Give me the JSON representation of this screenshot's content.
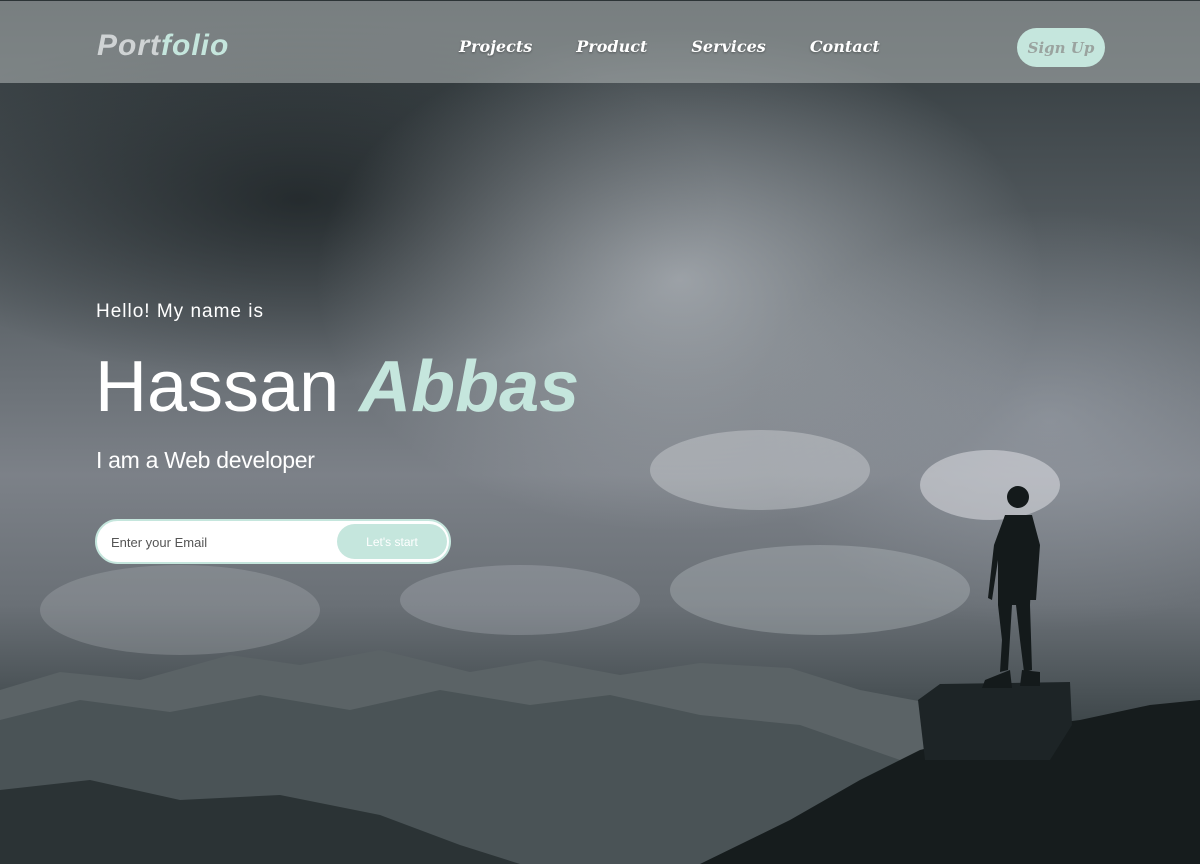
{
  "brand": {
    "logo_part1": "Port",
    "logo_part2": "folio"
  },
  "nav": {
    "items": [
      {
        "label": "Projects"
      },
      {
        "label": "Product"
      },
      {
        "label": "Services"
      },
      {
        "label": "Contact"
      }
    ],
    "signup_label": "Sign Up"
  },
  "hero": {
    "greeting": "Hello! My name is",
    "first_name": "Hassan",
    "last_name": "Abbas",
    "role": "I am a Web developer",
    "email_placeholder": "Enter your Email",
    "cta_label": "Let's start"
  },
  "colors": {
    "accent": "#c5e6dd",
    "text": "#ffffff"
  },
  "icons": {
    "hero_image": "mountain-landscape-silhouette"
  }
}
